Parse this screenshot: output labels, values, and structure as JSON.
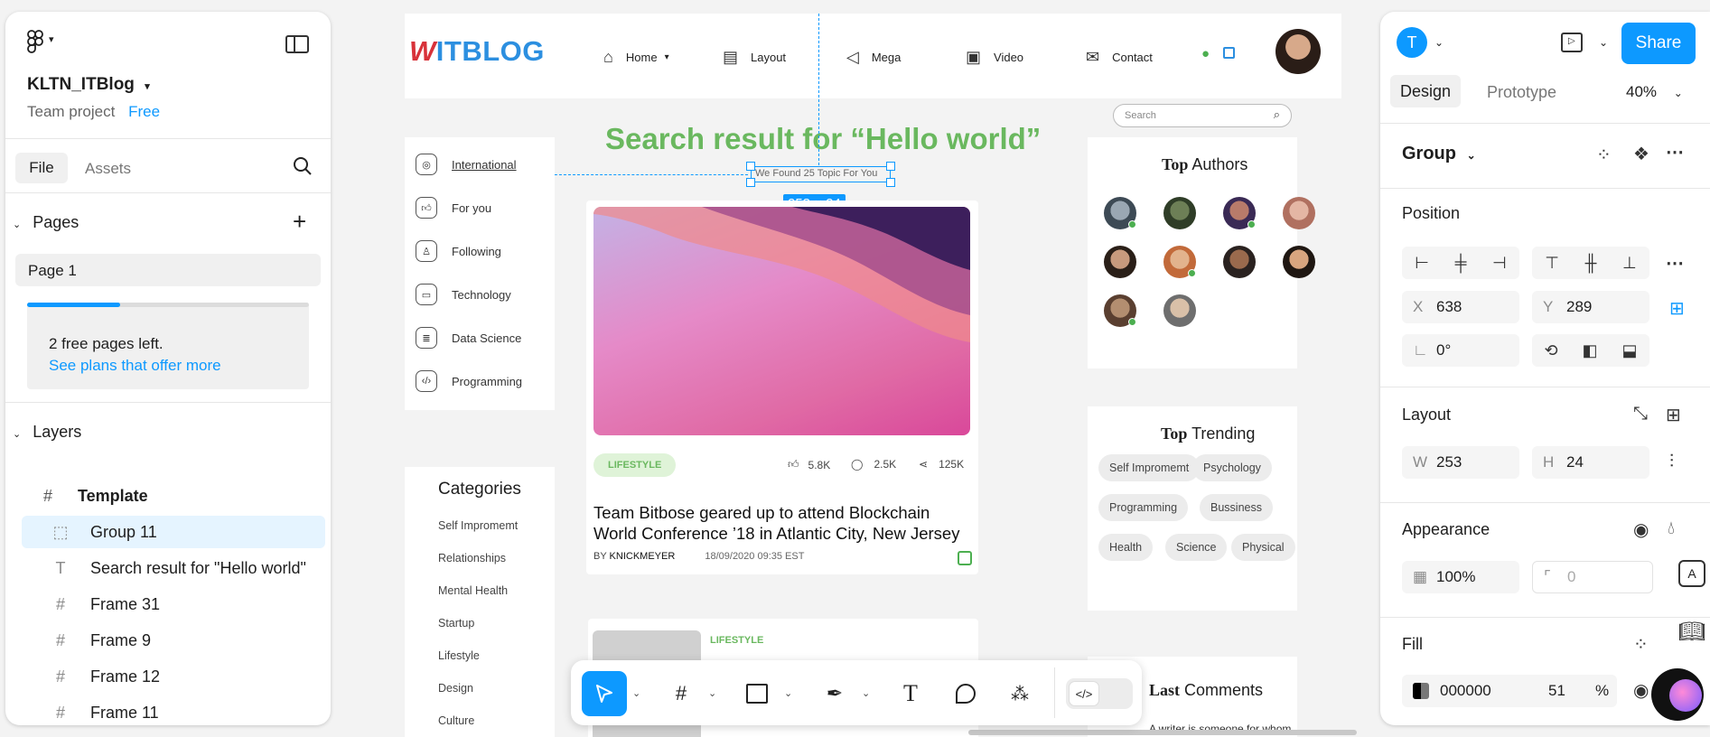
{
  "left_panel": {
    "file_name": "KLTN_ITBlog",
    "project": "Team project",
    "plan_badge": "Free",
    "tabs": [
      "File",
      "Assets"
    ],
    "pages_header": "Pages",
    "page": "Page 1",
    "free_pages_text": "2 free pages left.",
    "plans_link": "See plans that offer more",
    "progress": 0.33,
    "layers_header": "Layers",
    "layers": [
      {
        "icon": "#",
        "label": "Template"
      },
      {
        "icon": "⬚",
        "label": "Group 11"
      },
      {
        "icon": "T",
        "label": "Search result for \"Hello world\""
      },
      {
        "icon": "#",
        "label": "Frame 31"
      },
      {
        "icon": "#",
        "label": "Frame 9"
      },
      {
        "icon": "#",
        "label": "Frame 12"
      },
      {
        "icon": "#",
        "label": "Frame 11"
      }
    ]
  },
  "right_panel": {
    "avatar_letter": "T",
    "share_label": "Share",
    "tabs": [
      "Design",
      "Prototype"
    ],
    "zoom": "40%",
    "selection": "Group",
    "position_title": "Position",
    "x_label": "X",
    "x": "638",
    "y_label": "Y",
    "y": "289",
    "rotation": "0°",
    "layout_title": "Layout",
    "w_label": "W",
    "w": "253",
    "h_label": "H",
    "h": "24",
    "appearance_title": "Appearance",
    "opacity": "100%",
    "radius": "0",
    "fill_title": "Fill",
    "fill_hex": "000000",
    "fill_opacity": "51",
    "fill_unit": "%"
  },
  "canvas": {
    "size_badge": "253 × 24",
    "logo": "ITBLOG",
    "nav": [
      "Home",
      "Layout",
      "Mega",
      "Video",
      "Contact"
    ],
    "search_placeholder": "Search",
    "heading": "Search result for “Hello world”",
    "subheading": "We Found 25 Topic For You",
    "side_nav": [
      "International",
      "For you",
      "Following",
      "Technology",
      "Data Science",
      "Programming"
    ],
    "categories_title": "Categories",
    "categories": [
      "Self Impromemt",
      "Relationships",
      "Mental Health",
      "Startup",
      "Lifestyle",
      "Design",
      "Culture"
    ],
    "post": {
      "tag": "LIFESTYLE",
      "likes": "5.8K",
      "comments": "2.5K",
      "shares": "125K",
      "title": "Team Bitbose geared up to attend Blockchain World Conference ’18 in Atlantic City, New Jersey",
      "by": "BY",
      "author": "KNICKMEYER",
      "date": "18/09/2020 09:35 EST"
    },
    "post2_tag": "LIFESTYLE",
    "top_authors_bold": "Top",
    "top_authors_rest": "Authors",
    "top_trending_bold": "Top",
    "top_trending_rest": "Trending",
    "trending": [
      "Self Impromemt",
      "Psychology",
      "Programming",
      "Bussiness",
      "Health",
      "Science",
      "Physical"
    ],
    "last_comments_bold": "Last",
    "last_comments_rest": "Comments",
    "comment_snippet": "A writer is someone for whom"
  },
  "colors": {
    "accent": "#0d99ff",
    "heading_green": "#6ab85f",
    "logo_red": "#d8323a",
    "logo_blue": "#2c8fe0",
    "selection_bg": "#e5f4ff"
  }
}
